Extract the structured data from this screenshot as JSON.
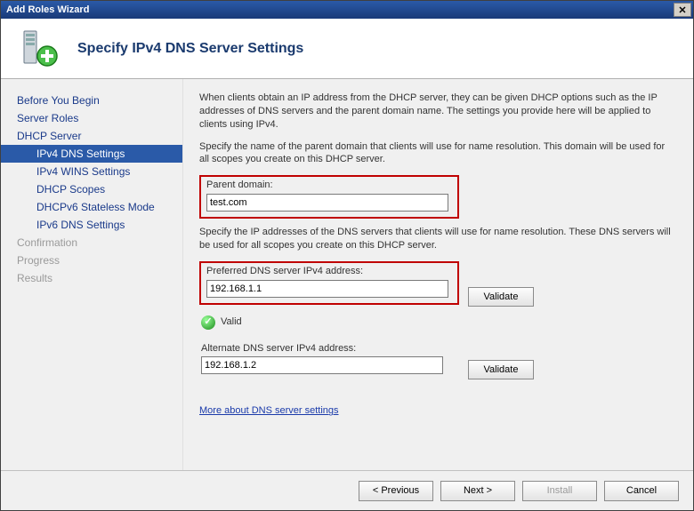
{
  "window_title": "Add Roles Wizard",
  "heading": "Specify IPv4 DNS Server Settings",
  "nav": [
    {
      "label": "Before You Begin",
      "type": "top"
    },
    {
      "label": "Server Roles",
      "type": "top"
    },
    {
      "label": "DHCP Server",
      "type": "top"
    },
    {
      "label": "IPv4 DNS Settings",
      "type": "child",
      "selected": true
    },
    {
      "label": "IPv4 WINS Settings",
      "type": "child"
    },
    {
      "label": "DHCP Scopes",
      "type": "child"
    },
    {
      "label": "DHCPv6 Stateless Mode",
      "type": "child"
    },
    {
      "label": "IPv6 DNS Settings",
      "type": "child"
    },
    {
      "label": "Confirmation",
      "type": "top",
      "disabled": true
    },
    {
      "label": "Progress",
      "type": "top",
      "disabled": true
    },
    {
      "label": "Results",
      "type": "top",
      "disabled": true
    }
  ],
  "paragraph1": "When clients obtain an IP address from the DHCP server, they can be given DHCP options such as the IP addresses of DNS servers and the parent domain name. The settings you provide here will be applied to clients using IPv4.",
  "paragraph2": "Specify the name of the parent domain that clients will use for name resolution. This domain will be used for all scopes you create on this DHCP server.",
  "parent_domain_label": "Parent domain:",
  "parent_domain_value": "test.com",
  "paragraph3": "Specify the IP addresses of the DNS servers that clients will use for name resolution. These DNS servers will be used for all scopes you create on this DHCP server.",
  "preferred_label": "Preferred DNS server IPv4 address:",
  "preferred_value": "192.168.1.1",
  "validate_label": "Validate",
  "valid_status": "Valid",
  "alternate_label": "Alternate DNS server IPv4 address:",
  "alternate_value": "192.168.1.2",
  "more_link": "More about DNS server settings",
  "buttons": {
    "previous": "< Previous",
    "next": "Next >",
    "install": "Install",
    "cancel": "Cancel"
  }
}
